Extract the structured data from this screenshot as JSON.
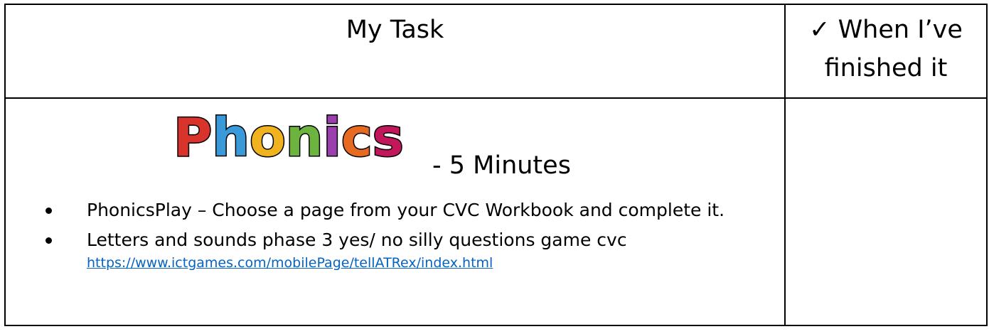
{
  "header": {
    "task_label": "My Task",
    "done_check": "✓",
    "done_line1": "When I’ve",
    "done_line2": "finished it"
  },
  "task": {
    "logo_text": "Phonics",
    "logo_colors": [
      "#d9342b",
      "#3a9ad9",
      "#f0b21f",
      "#6cb33f",
      "#9b3fae",
      "#e66a1f",
      "#c2185b"
    ],
    "duration": "- 5 Minutes",
    "bullets": [
      {
        "text": "PhonicsPlay – Choose a page from your CVC Workbook and complete it."
      },
      {
        "text": "Letters and sounds phase 3 yes/ no silly questions game cvc",
        "link": "https://www.ictgames.com/mobilePage/tellATRex/index.html"
      }
    ]
  }
}
